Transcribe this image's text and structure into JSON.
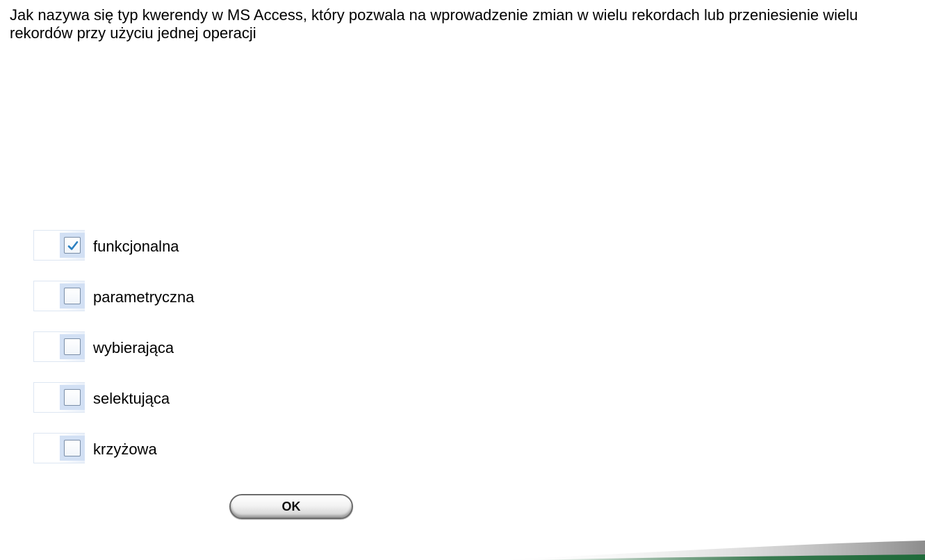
{
  "question": {
    "text": "Jak nazywa się typ kwerendy w MS Access, który pozwala na wprowadzenie zmian w wielu rekordach lub przeniesienie wielu rekordów przy użyciu jednej operacji"
  },
  "options": [
    {
      "label": "funkcjonalna",
      "checked": true
    },
    {
      "label": "parametryczna",
      "checked": false
    },
    {
      "label": "wybierająca",
      "checked": false
    },
    {
      "label": "selektująca",
      "checked": false
    },
    {
      "label": "krzyżowa",
      "checked": false
    }
  ],
  "ok_button": {
    "label": "OK"
  },
  "colors": {
    "accent_green": "#1f6b3a",
    "checkbox_highlight": "#d2e0f4",
    "checkmark": "#2a7fc0"
  }
}
